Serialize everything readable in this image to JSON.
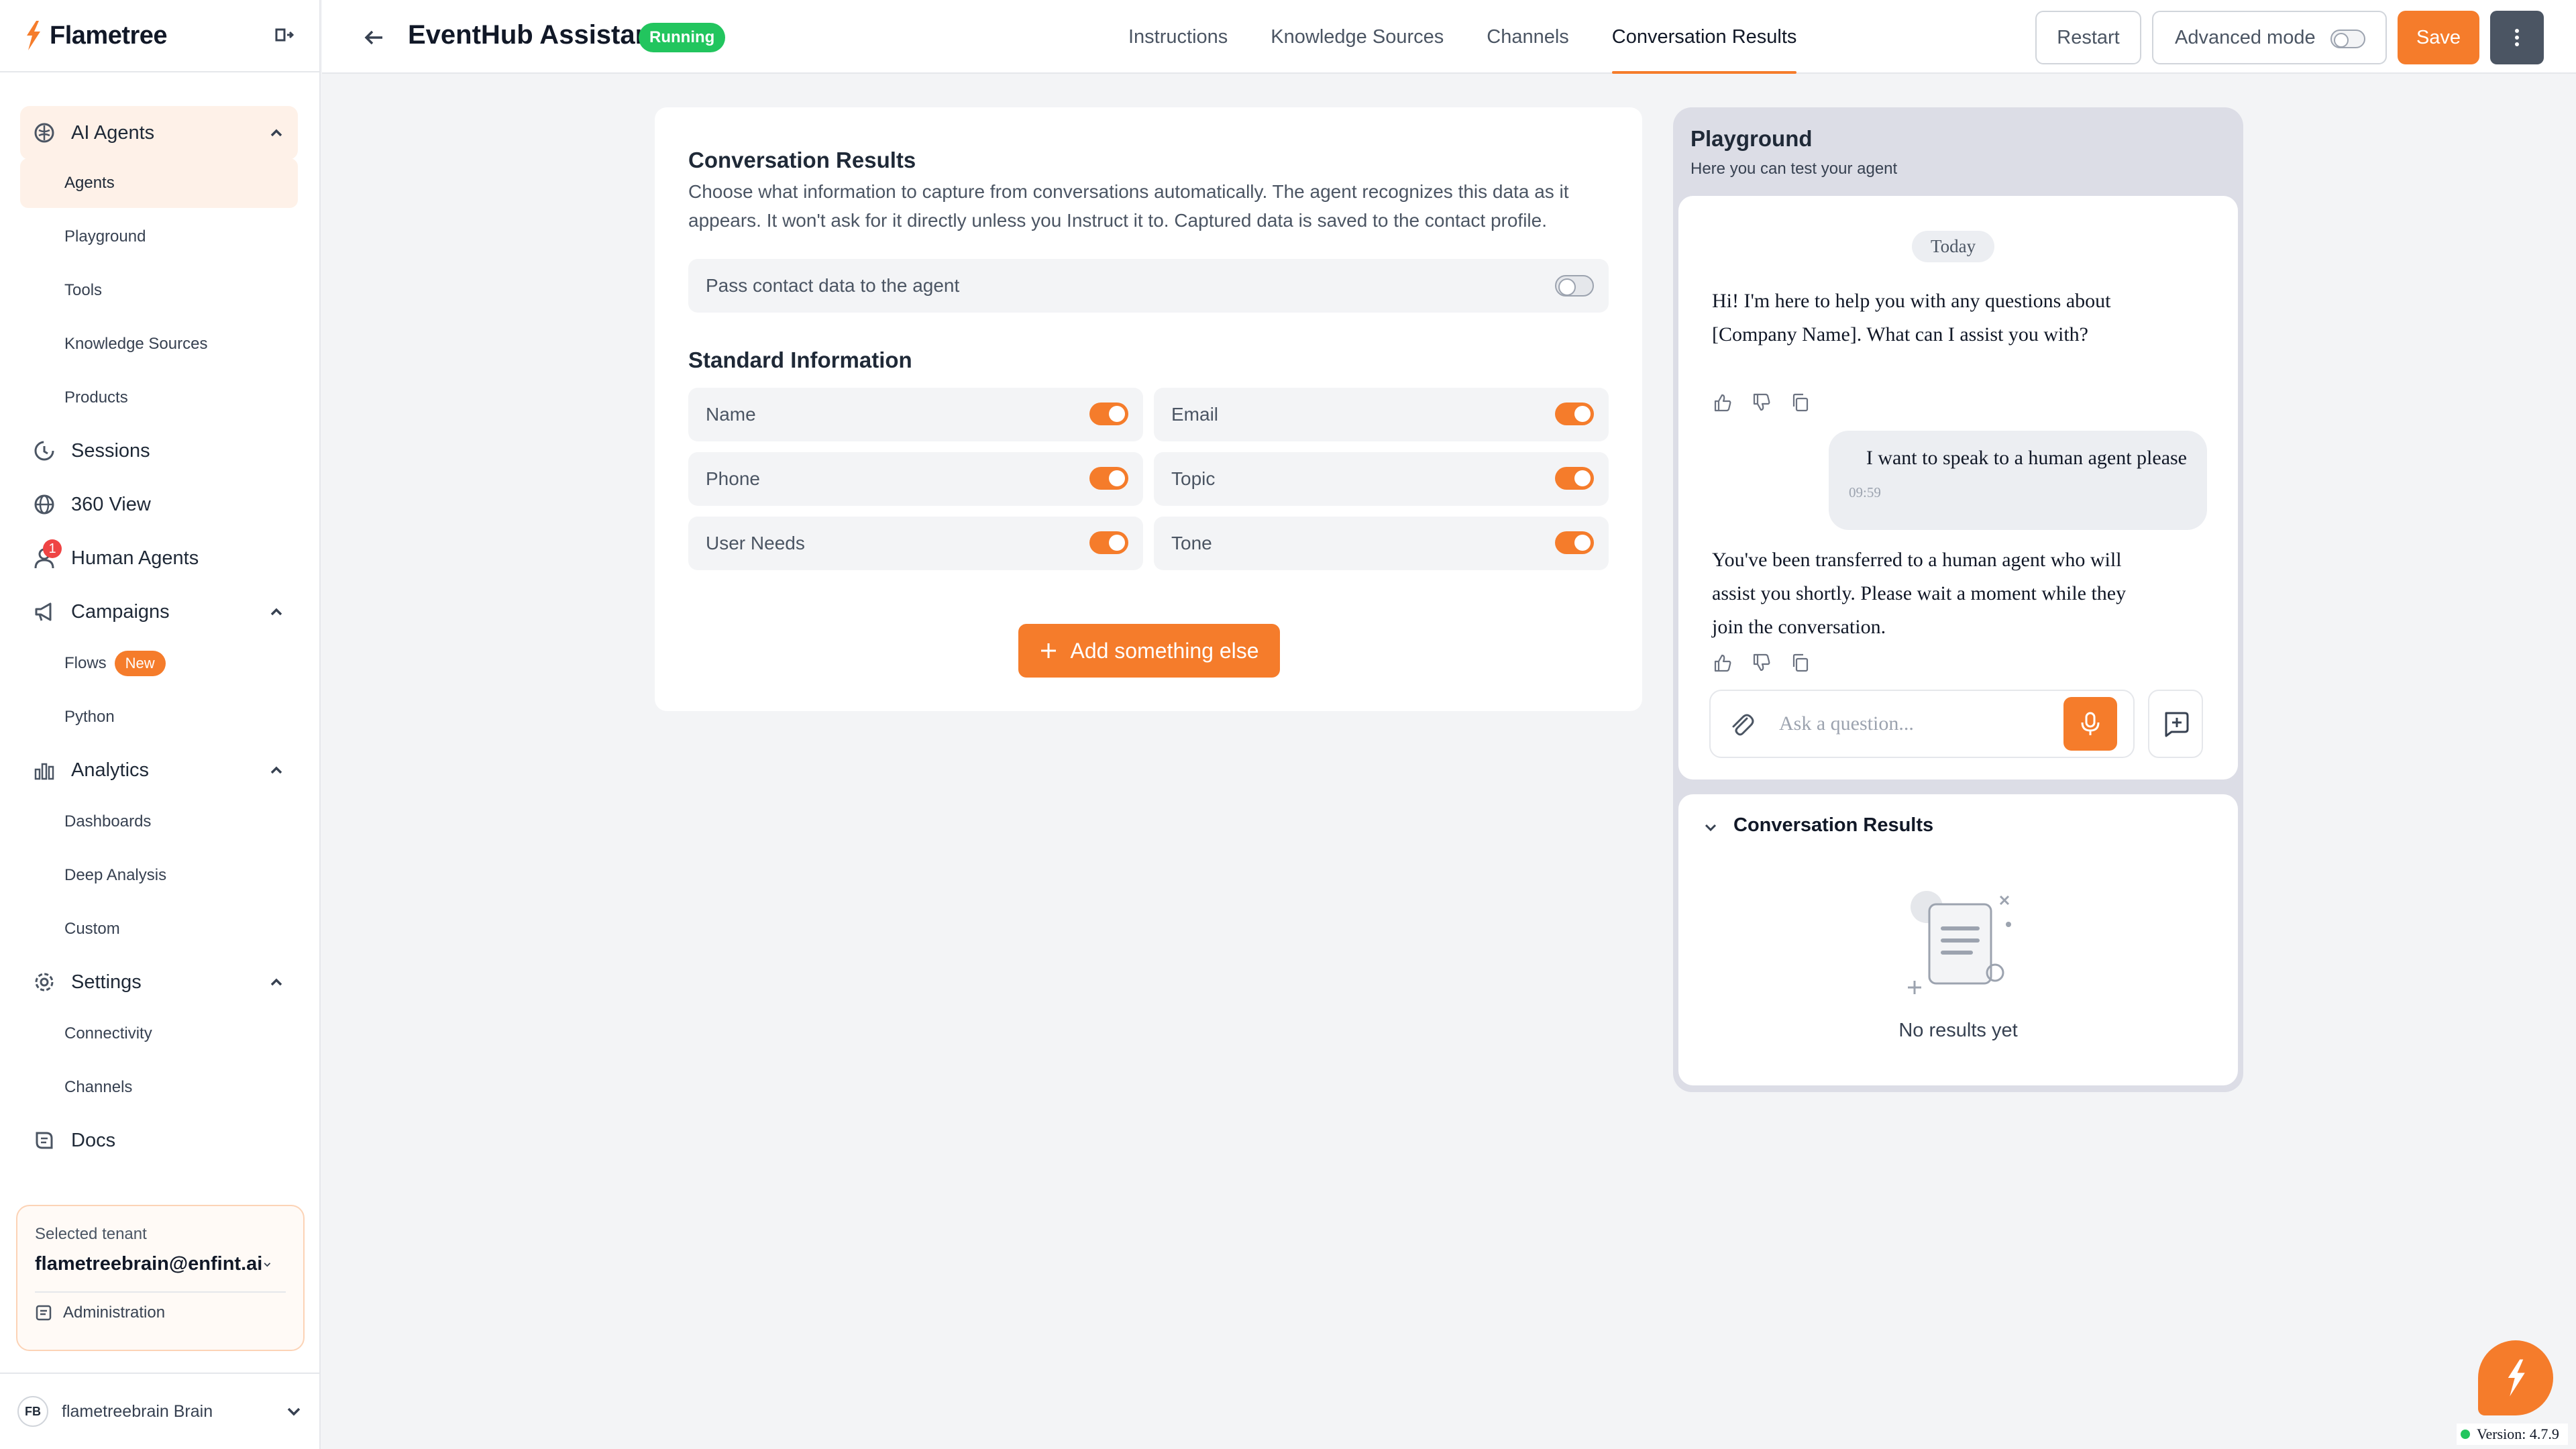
{
  "brand": {
    "name": "Flametree",
    "accent": "#f57c2b"
  },
  "sidebar": {
    "sections": [
      {
        "label": "AI Agents",
        "icon": "brain-icon"
      },
      {
        "label": "Sessions",
        "icon": "history-icon"
      },
      {
        "label": "360 View",
        "icon": "globe-icon"
      },
      {
        "label": "Human Agents",
        "icon": "user-icon",
        "badge": "1"
      },
      {
        "label": "Campaigns",
        "icon": "megaphone-icon"
      },
      {
        "label": "Analytics",
        "icon": "chart-icon"
      },
      {
        "label": "Settings",
        "icon": "gear-icon"
      },
      {
        "label": "Docs",
        "icon": "book-icon"
      }
    ],
    "ai_agents_items": [
      "Agents",
      "Playground",
      "Tools",
      "Knowledge Sources",
      "Products"
    ],
    "campaigns_items": [
      "Flows",
      "Python"
    ],
    "flows_badge": "New",
    "analytics_items": [
      "Dashboards",
      "Deep Analysis",
      "Custom"
    ],
    "settings_items": [
      "Connectivity",
      "Channels"
    ],
    "tenant": {
      "label": "Selected tenant",
      "name": "flametreebrain@enfint.ai",
      "admin_label": "Administration"
    },
    "user": {
      "initials": "FB",
      "name": "flametreebrain Brain"
    }
  },
  "header": {
    "agent_name": "EventHub Assistant",
    "status": "Running",
    "tabs": [
      "Instructions",
      "Knowledge Sources",
      "Channels",
      "Conversation Results"
    ],
    "active_tab": "Conversation Results",
    "restart_label": "Restart",
    "advanced_label": "Advanced mode",
    "save_label": "Save"
  },
  "main": {
    "title": "Conversation Results",
    "description": "Choose what information to capture from conversations automatically. The agent recognizes this data as it appears. It won't ask for it directly unless you Instruct it to. Captured data is saved to the contact profile.",
    "pass_contact_label": "Pass contact data to the agent",
    "pass_contact_enabled": false,
    "standard_title": "Standard Information",
    "fields": [
      {
        "label": "Name",
        "enabled": true
      },
      {
        "label": "Email",
        "enabled": true
      },
      {
        "label": "Phone",
        "enabled": true
      },
      {
        "label": "Topic",
        "enabled": true
      },
      {
        "label": "User Needs",
        "enabled": true
      },
      {
        "label": "Tone",
        "enabled": true
      }
    ],
    "add_label": "Add something else"
  },
  "playground": {
    "title": "Playground",
    "subtitle": "Here you can test your agent",
    "date_pill": "Today",
    "messages": [
      {
        "role": "bot",
        "text": "Hi! I'm here to help you with any questions about [Company Name]. What can I assist you with?"
      },
      {
        "role": "user",
        "text": "I want to speak to a human agent please",
        "time": "09:59"
      },
      {
        "role": "bot",
        "text": "You've been transferred to a human agent who will assist you shortly. Please wait a moment while they join the conversation."
      }
    ],
    "input_placeholder": "Ask a question...",
    "results_title": "Conversation Results",
    "empty_text": "No results yet"
  },
  "footer": {
    "version": "Version: 4.7.9"
  }
}
